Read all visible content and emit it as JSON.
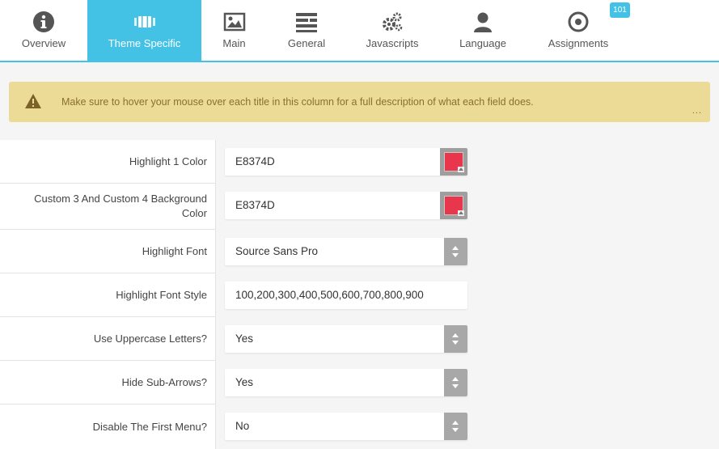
{
  "tabs": [
    {
      "label": "Overview",
      "icon": "info-icon",
      "active": false
    },
    {
      "label": "Theme Specific",
      "icon": "theme-columns-icon",
      "active": true
    },
    {
      "label": "Main",
      "icon": "image-icon",
      "active": false
    },
    {
      "label": "General",
      "icon": "list-lines-icon",
      "active": false
    },
    {
      "label": "Javascripts",
      "icon": "gears-icon",
      "active": false
    },
    {
      "label": "Language",
      "icon": "user-icon",
      "active": false
    },
    {
      "label": "Assignments",
      "icon": "target-icon",
      "active": false
    }
  ],
  "assignments_badge": "101",
  "alert": {
    "message": "Make sure to hover your mouse over each title in this column for a full description of what each field does.",
    "more": "..."
  },
  "fields": [
    {
      "label": "Highlight 1 Color",
      "value": "E8374D",
      "type": "color",
      "color": "#E8374D"
    },
    {
      "label": "Custom 3 And Custom 4 Background Color",
      "value": "E8374D",
      "type": "color",
      "color": "#E8374D"
    },
    {
      "label": "Highlight Font",
      "value": "Source Sans Pro",
      "type": "select"
    },
    {
      "label": "Highlight Font Style",
      "value": "100,200,300,400,500,600,700,800,900",
      "type": "text"
    },
    {
      "label": "Use Uppercase Letters?",
      "value": "Yes",
      "type": "select"
    },
    {
      "label": "Hide Sub-Arrows?",
      "value": "Yes",
      "type": "select"
    },
    {
      "label": "Disable The First Menu?",
      "value": "No",
      "type": "select"
    }
  ],
  "colors": {
    "accent": "#44c2e5",
    "alert_bg": "#ecdb97",
    "highlight": "#E8374D"
  }
}
